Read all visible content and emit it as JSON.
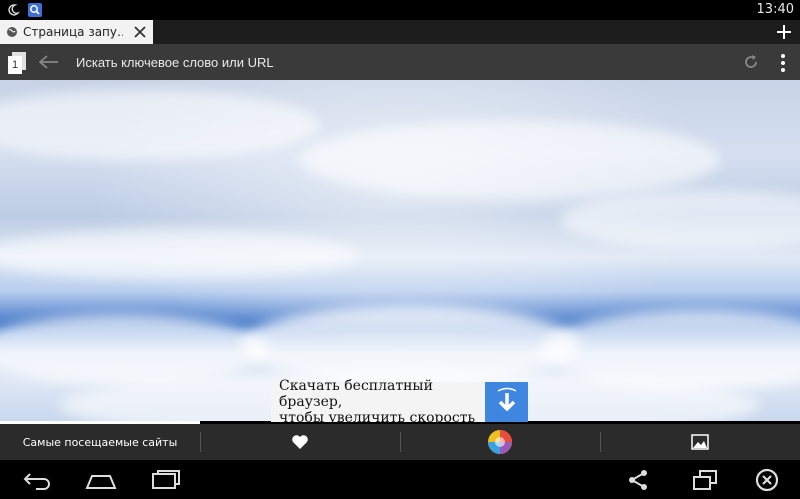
{
  "statusbar": {
    "time": "13:40",
    "icons": [
      "moon-icon",
      "search-app-icon"
    ]
  },
  "tab": {
    "title": "Страница запу…",
    "icon": "globe-icon",
    "close_icon": "close-icon"
  },
  "new_tab_icon": "plus-icon",
  "address_bar": {
    "tabs_count": "1",
    "placeholder": "Искать ключевое слово или URL",
    "back_icon": "arrow-left-icon",
    "reload_icon": "reload-icon",
    "menu_icon": "overflow-menu-icon"
  },
  "promo": {
    "text_line1": "Скачать бесплатный браузер,",
    "text_line2": "чтобы увеличить скорость",
    "button_icon": "download-arrow-icon",
    "button_color": "#3f86e0"
  },
  "bottom_bar": {
    "most_visited_label": "Самые посещаемые сайты",
    "favorites_icon": "heart-icon",
    "apps_icon": "colorful-ball-icon",
    "wallpaper_icon": "image-icon"
  },
  "navbar": {
    "icons": [
      "back-nav-icon",
      "home-icon",
      "recent-apps-icon",
      "share-icon",
      "window-icon",
      "close-circle-icon"
    ]
  }
}
